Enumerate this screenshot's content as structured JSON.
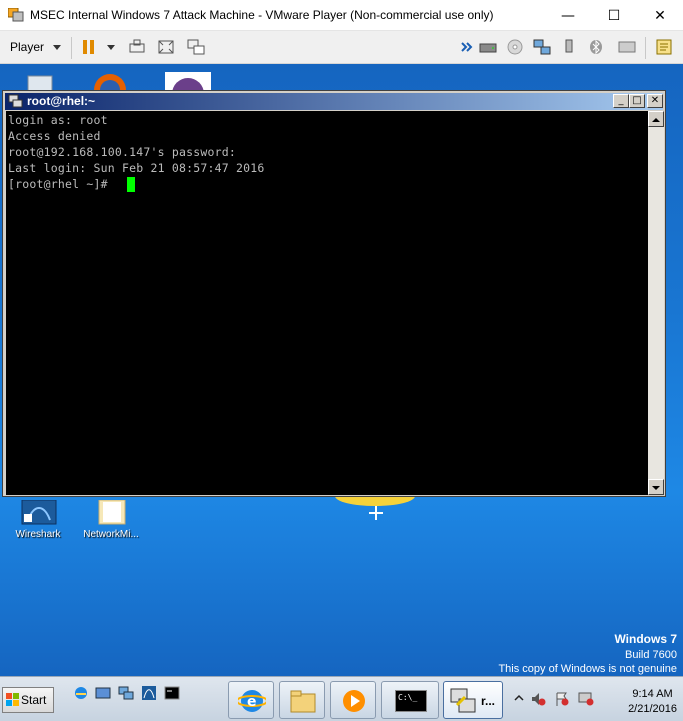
{
  "host": {
    "title": "MSEC Internal Windows 7 Attack Machine - VMware Player (Non-commercial use only)",
    "player_menu": "Player",
    "controls": {
      "minimize": "—",
      "maximize": "☐",
      "close": "✕"
    }
  },
  "putty": {
    "title": "root@rhel:~",
    "lines": [
      "login as: root",
      "Access denied",
      "root@192.168.100.147's password:",
      "Last login: Sun Feb 21 08:57:47 2016",
      "[root@rhel ~]#"
    ],
    "cursor_color": "#00ff00"
  },
  "desktop": {
    "icons": [
      {
        "label": "Wireshark"
      },
      {
        "label": "NetworkMi..."
      }
    ],
    "watermark": {
      "os": "Windows 7",
      "build": "Build 7600",
      "notice": "This copy of Windows is not genuine"
    }
  },
  "taskbar": {
    "start_label": "Start",
    "cmd_label": "C:\\_",
    "putty_task_label": "r...",
    "clock": {
      "time": "9:14 AM",
      "date": "2/21/2016"
    }
  }
}
